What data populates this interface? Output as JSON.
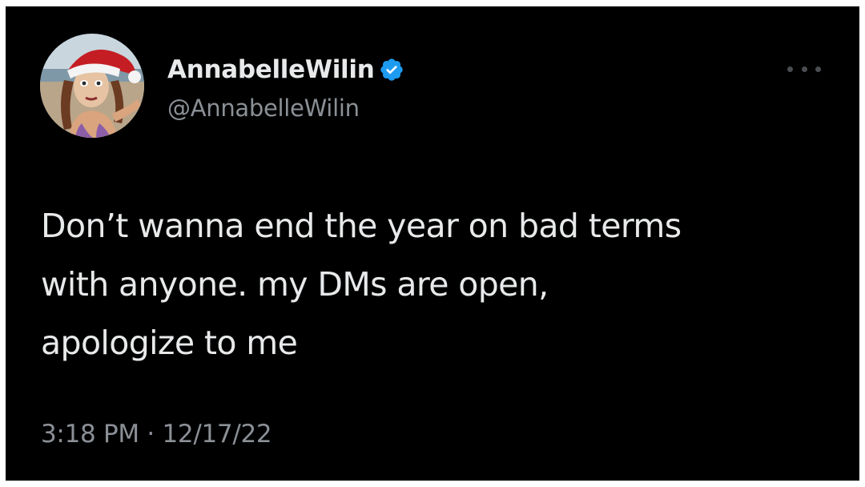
{
  "tweet": {
    "display_name": "AnnabelleWilin",
    "handle": "@AnnabelleWilin",
    "verified": true,
    "text_lines": [
      "Don’t wanna end the year on bad terms",
      "with anyone. my DMs are open,",
      "apologize to me"
    ],
    "time": "3:18 PM",
    "separator": "·",
    "date": "12/17/22"
  },
  "icons": {
    "avatar": "avatar-image",
    "verified": "verified-badge-icon",
    "more": "more-options-icon"
  },
  "colors": {
    "background": "#000000",
    "primary_text": "#e7e9ea",
    "secondary_text": "#8b9096",
    "verified_blue": "#1d9bf0"
  }
}
